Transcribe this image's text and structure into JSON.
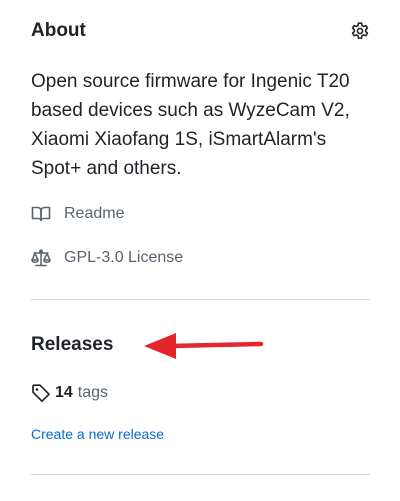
{
  "about": {
    "title": "About",
    "settings_icon": "gear-icon",
    "description": "Open source firmware for Ingenic T20 based devices such as WyzeCam V2, Xiaomi Xiaofang 1S, iSmartAlarm's Spot+ and others.",
    "readme": {
      "icon": "book-icon",
      "label": "Readme"
    },
    "license": {
      "icon": "law-icon",
      "label": "GPL-3.0 License"
    }
  },
  "releases": {
    "title": "Releases",
    "tags": {
      "icon": "tag-icon",
      "count": "14",
      "label": "tags"
    },
    "create_link": "Create a new release"
  },
  "annotation": {
    "arrow_color": "#e3262b"
  },
  "colors": {
    "text": "#1f2328",
    "muted": "#59636e",
    "link": "#0969da",
    "divider": "#d1d9e0"
  }
}
